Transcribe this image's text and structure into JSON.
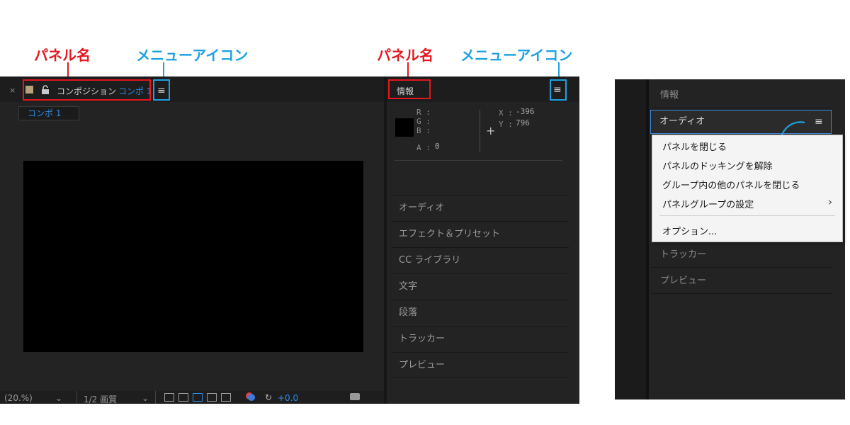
{
  "annotations": {
    "panel_name": "パネル名",
    "menu_icon": "メニューアイコン",
    "colors": {
      "red": "#e4161e",
      "blue": "#1ea1e0"
    }
  },
  "comp_panel": {
    "close_glyph": "×",
    "lock_icon": "lock-icon",
    "title_prefix": "コンポジション",
    "title_comp": "コンポ 1",
    "menu_glyph": "≡",
    "subtab": "コンポ 1",
    "toolbar": {
      "zoom": "(20.%)",
      "quality": "1/2 画質",
      "offset": "+0.0"
    }
  },
  "info_panel": {
    "title": "情報",
    "menu_glyph": "≡",
    "r_label": "R :",
    "g_label": "G :",
    "b_label": "B :",
    "a_label": "A :",
    "a_value": "0",
    "x_label": "X :",
    "x_value": "-396",
    "y_label": "Y :",
    "y_value": "796",
    "crosshair": "+"
  },
  "panel_items": [
    "オーディオ",
    "エフェクト＆プリセット",
    "CC ライブラリ",
    "文字",
    "段落",
    "トラッカー",
    "プレビュー"
  ],
  "mini": {
    "info_title": "情報",
    "audio_title": "オーディオ",
    "menu_glyph": "≡",
    "menu_items": [
      "パネルを閉じる",
      "パネルのドッキングを解除",
      "グループ内の他のパネルを閉じる",
      "パネルグループの設定",
      "オプション..."
    ],
    "submenu_arrow": "›",
    "bottom_items": [
      "トラッカー",
      "プレビュー"
    ]
  }
}
